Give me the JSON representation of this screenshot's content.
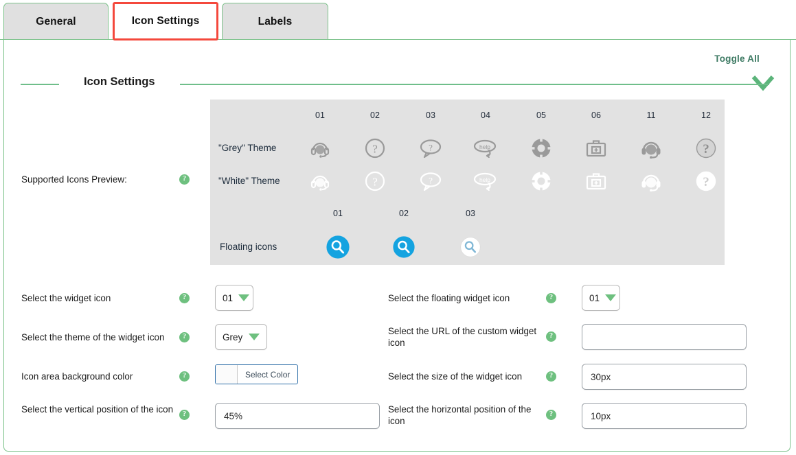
{
  "tabs": [
    {
      "label": "General",
      "active": false
    },
    {
      "label": "Icon Settings",
      "active": true
    },
    {
      "label": "Labels",
      "active": false
    }
  ],
  "toolbar": {
    "toggle_all": "Toggle All",
    "toggle_icon": "chevron-down-icon"
  },
  "section": {
    "title": "Icon Settings"
  },
  "preview": {
    "label": "Supported Icons Preview:",
    "help_icon": "question-help-icon",
    "theme_columns": [
      "01",
      "02",
      "03",
      "04",
      "05",
      "06",
      "11",
      "12"
    ],
    "rows": [
      {
        "label": "\"Grey\" Theme",
        "theme": "grey",
        "icons": [
          "headset-icon",
          "question-circle-icon",
          "question-bubble-icon",
          "help-bubble-icon",
          "life-ring-icon",
          "first-aid-kit-icon",
          "headset-filled-icon",
          "question-circle-filled-icon"
        ]
      },
      {
        "label": "\"White\" Theme",
        "theme": "white",
        "icons": [
          "headset-icon",
          "question-circle-icon",
          "question-bubble-icon",
          "help-bubble-icon",
          "life-ring-icon",
          "first-aid-kit-icon",
          "headset-filled-icon",
          "question-circle-filled-icon"
        ]
      }
    ],
    "floating_columns": [
      "01",
      "02",
      "03"
    ],
    "floating_label": "Floating icons",
    "floating_icons": [
      "magnifier-blue-filled-icon",
      "magnifier-blue-filled-icon",
      "magnifier-white-icon"
    ],
    "help_bubble_text": "help",
    "colors": {
      "panel_background": "#e2e2e2",
      "grey_icon": "#9a9a9a",
      "white_icon": "#ffffff",
      "floating_blue": "#14a3e0"
    }
  },
  "fields": {
    "widget_icon": {
      "label": "Select the widget icon",
      "help_icon": "question-help-icon",
      "value": "01",
      "control": "dropdown"
    },
    "floating_widget_icon": {
      "label": "Select the floating widget icon",
      "help_icon": "question-help-icon",
      "value": "01",
      "control": "dropdown"
    },
    "widget_icon_theme": {
      "label": "Select the theme of the widget icon",
      "help_icon": "question-help-icon",
      "value": "Grey",
      "control": "dropdown"
    },
    "custom_icon_url": {
      "label": "Select the URL of the custom widget icon",
      "help_icon": "question-help-icon",
      "value": "",
      "placeholder": "",
      "control": "text"
    },
    "icon_area_bg_color": {
      "label": "Icon area background color",
      "help_icon": "question-help-icon",
      "button_label": "Select Color",
      "swatch_color": "#fbfbfb",
      "control": "color-picker"
    },
    "widget_icon_size": {
      "label": "Select the size of the widget icon",
      "help_icon": "question-help-icon",
      "value": "30px",
      "control": "text"
    },
    "vertical_position": {
      "label": "Select the vertical position of the icon",
      "help_icon": "question-help-icon",
      "value": "45%",
      "control": "text"
    },
    "horizontal_position": {
      "label": "Select the horizontal position of the icon",
      "help_icon": "question-help-icon",
      "value": "10px",
      "control": "text"
    }
  },
  "theme_colors": {
    "tab_border": "#7cc28a",
    "active_tab_highlight": "#f4483c",
    "accent_green": "#6ec07f",
    "toggle_text": "#3d7a63"
  }
}
